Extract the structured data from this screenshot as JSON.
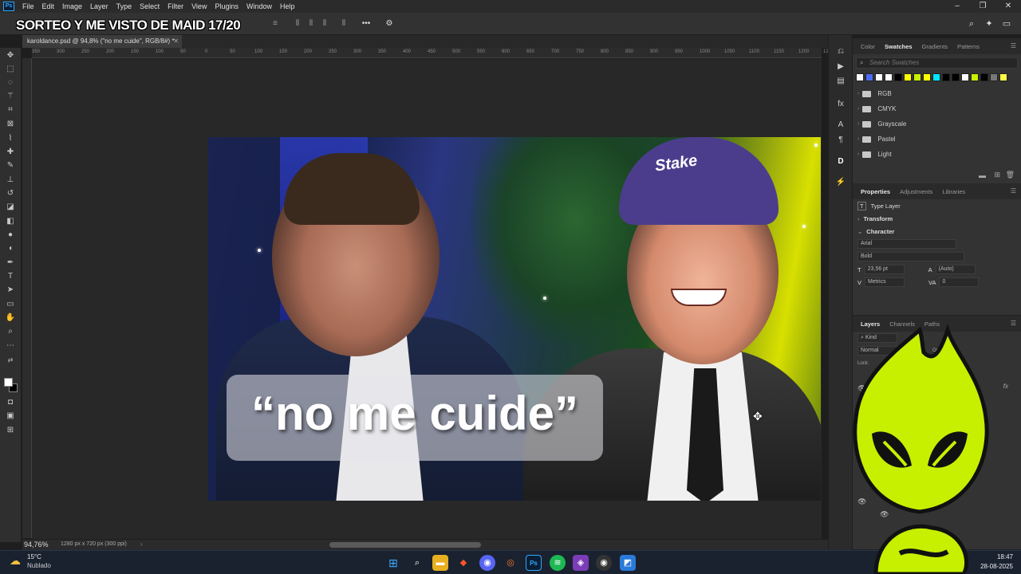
{
  "overlay_title": "SORTEO Y ME VISTO DE MAID 17/20",
  "menu": [
    "File",
    "Edit",
    "Image",
    "Layer",
    "Type",
    "Select",
    "Filter",
    "View",
    "Plugins",
    "Window",
    "Help"
  ],
  "document_tab": "karoldance.psd @ 94,8% (\"no me cuide\", RGB/8#) *",
  "ruler_ticks": [
    "350",
    "300",
    "250",
    "200",
    "150",
    "100",
    "50",
    "0",
    "50",
    "100",
    "150",
    "200",
    "250",
    "300",
    "350",
    "400",
    "450",
    "500",
    "550",
    "600",
    "650",
    "700",
    "750",
    "800",
    "850",
    "900",
    "950",
    "1000",
    "1050",
    "1100",
    "1150",
    "1200",
    "1250"
  ],
  "canvas": {
    "caption": "“no me cuide”",
    "cap_logo": "Stake"
  },
  "status": {
    "zoom": "94,76%",
    "doc_info": "1280 px x 720 px (300 ppi)"
  },
  "swatches_panel": {
    "tabs": [
      "Color",
      "Swatches",
      "Gradients",
      "Patterns"
    ],
    "active_tab": "Swatches",
    "search_placeholder": "Search Swatches",
    "colors": [
      "#ffffff",
      "#4a6cf7",
      "#ffffff",
      "#ffffff",
      "#000000",
      "#ffff00",
      "#c8f000",
      "#ffff00",
      "#00e5ff",
      "#000000",
      "#000000",
      "#ffffff",
      "#c8f000",
      "#000000",
      "#777777",
      "#ffff44"
    ],
    "folders": [
      "RGB",
      "CMYK",
      "Grayscale",
      "Pastel",
      "Light"
    ]
  },
  "properties_panel": {
    "tabs": [
      "Properties",
      "Adjustments",
      "Libraries"
    ],
    "active_tab": "Properties",
    "layer_type": "Type Layer",
    "transform_label": "Transform",
    "character_label": "Character",
    "font_family": "Arial",
    "font_style": "Bold",
    "font_size": "23,56 pt",
    "leading": "(Auto)",
    "kerning": "Metrics",
    "tracking": "0"
  },
  "layers_panel": {
    "tabs": [
      "Layers",
      "Channels",
      "Paths"
    ],
    "active_tab": "Layers",
    "filter_kind": "Kind",
    "blend_mode": "Normal",
    "opacity_label": "Opacity:",
    "lock_label": "Lock:"
  },
  "taskbar": {
    "temperature": "15°C",
    "weather": "Nublado",
    "time": "18:47",
    "date": "28-08-2025"
  },
  "colors": {
    "ps_blue": "#31a8ff",
    "mascot_green": "#c6f000",
    "taskbar_bg": "#1a2230"
  }
}
